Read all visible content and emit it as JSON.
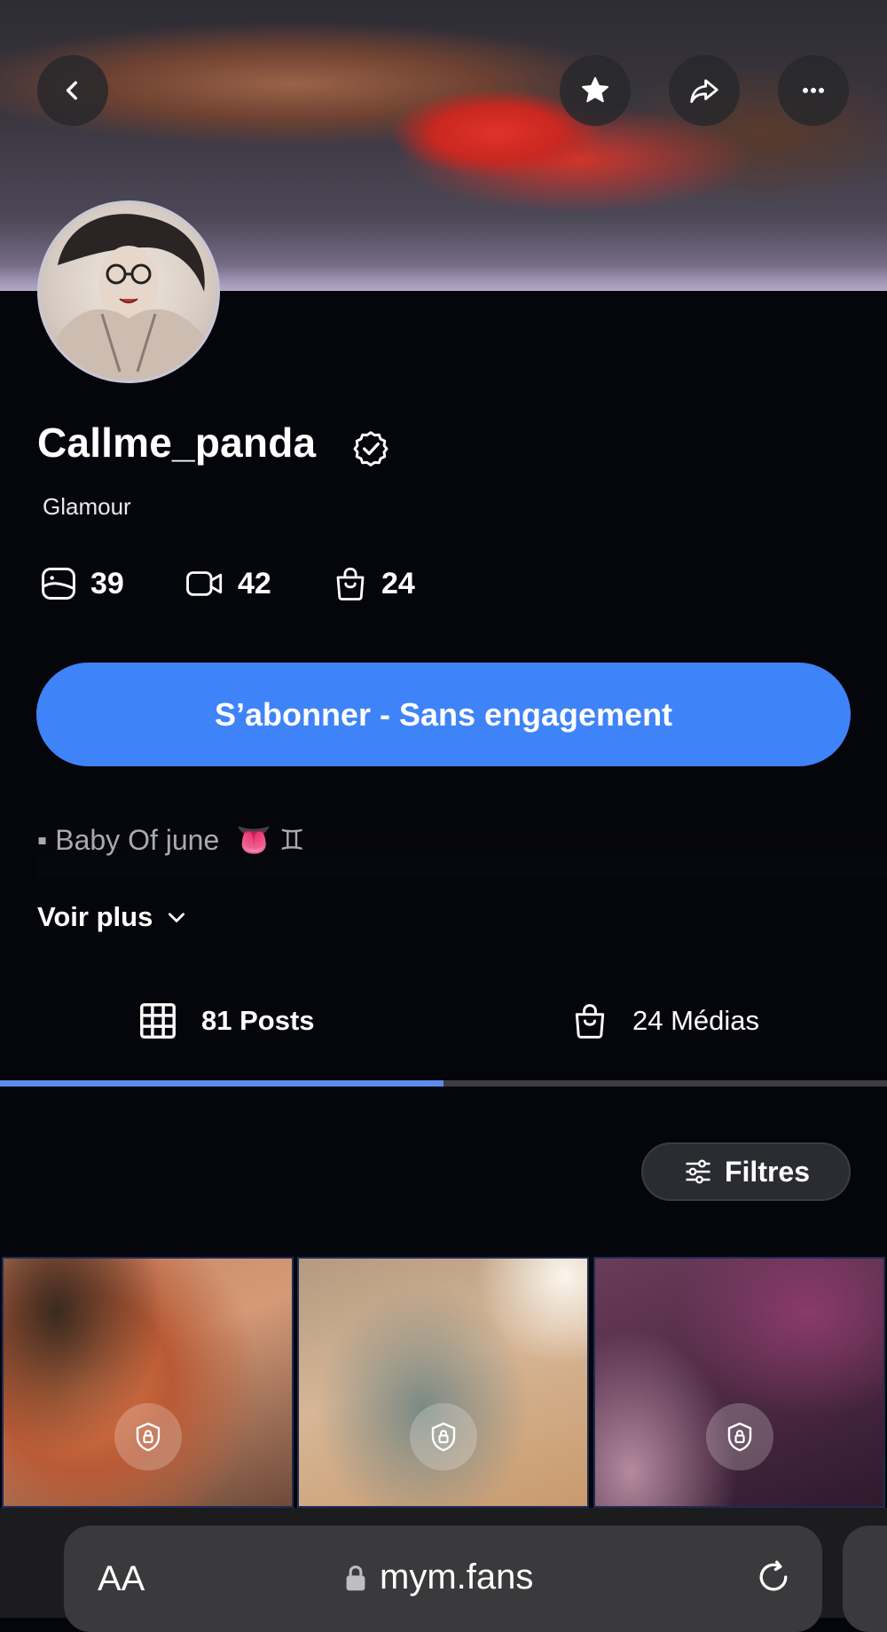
{
  "profile": {
    "username": "Callme_panda",
    "category": "Glamour",
    "stats": {
      "photos": "39",
      "videos": "42",
      "products": "24"
    }
  },
  "subscribe_button": "S’abonner - Sans engagement",
  "bio": {
    "text": "▪ Baby Of june",
    "emojis": "👅 ♊",
    "more_label": "Voir plus"
  },
  "tabs": [
    {
      "label": "81 Posts",
      "icon": "grid-icon",
      "active": true
    },
    {
      "label": "24 Médias",
      "icon": "bag-icon",
      "active": false
    }
  ],
  "filters_label": "Filtres",
  "posts": [
    {
      "locked": true,
      "icon": "lock-icon"
    },
    {
      "locked": true,
      "icon": "lock-icon"
    },
    {
      "locked": true,
      "icon": "lock-icon"
    }
  ],
  "browser": {
    "text_size_label": "AA",
    "url": "mym.fans"
  },
  "colors": {
    "accent": "#3f83f8",
    "tab_active": "#5b8def",
    "background": "#05060b"
  }
}
